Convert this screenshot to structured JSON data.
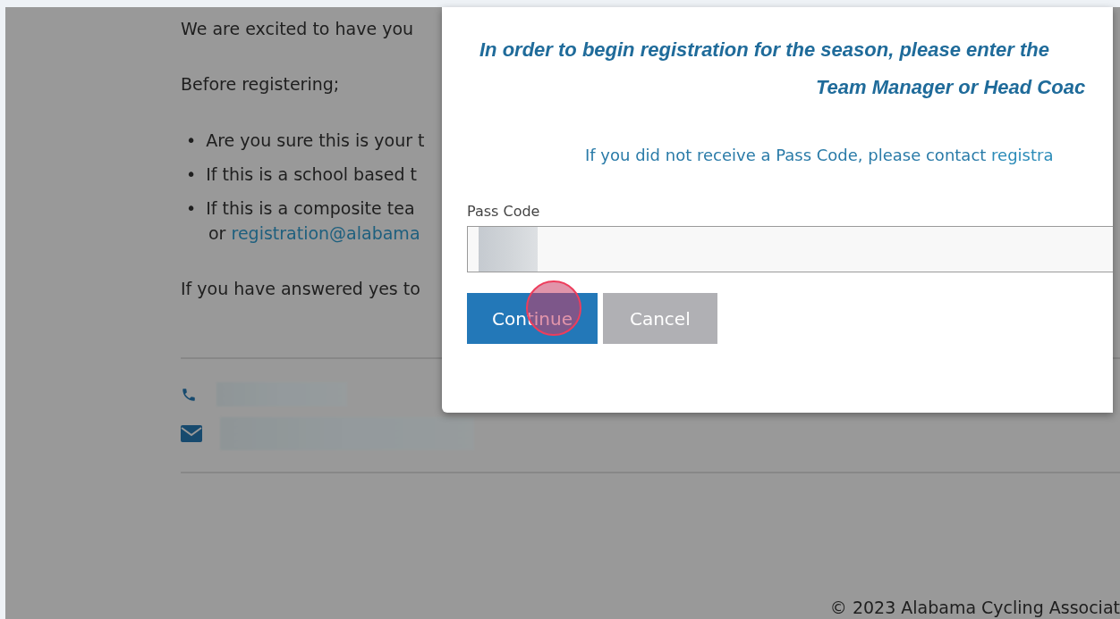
{
  "page": {
    "intro": "We are excited to have you",
    "before": "Before registering;",
    "bullet_marker": "•",
    "bullets": [
      "Are you sure this is your t",
      "If this is a school based t",
      "If this is a composite tea"
    ],
    "bullet_tail": {
      "text": "or",
      "link": "registration@alabama"
    },
    "closing": "If you have answered yes to"
  },
  "footer": {
    "copyright": "© 2023 Alabama Cycling Associat"
  },
  "dialog": {
    "heading_lines": [
      "In order to begin registration for the season, please enter the",
      "Team Manager or Head Coac"
    ],
    "info": {
      "text": "If you did not receive a Pass Code, please contact",
      "link": "registra"
    },
    "field": {
      "label": "Pass Code"
    },
    "buttons": [
      {
        "label": "Continue",
        "kind": "primary"
      },
      {
        "label": "Cancel",
        "kind": "secondary"
      }
    ]
  }
}
